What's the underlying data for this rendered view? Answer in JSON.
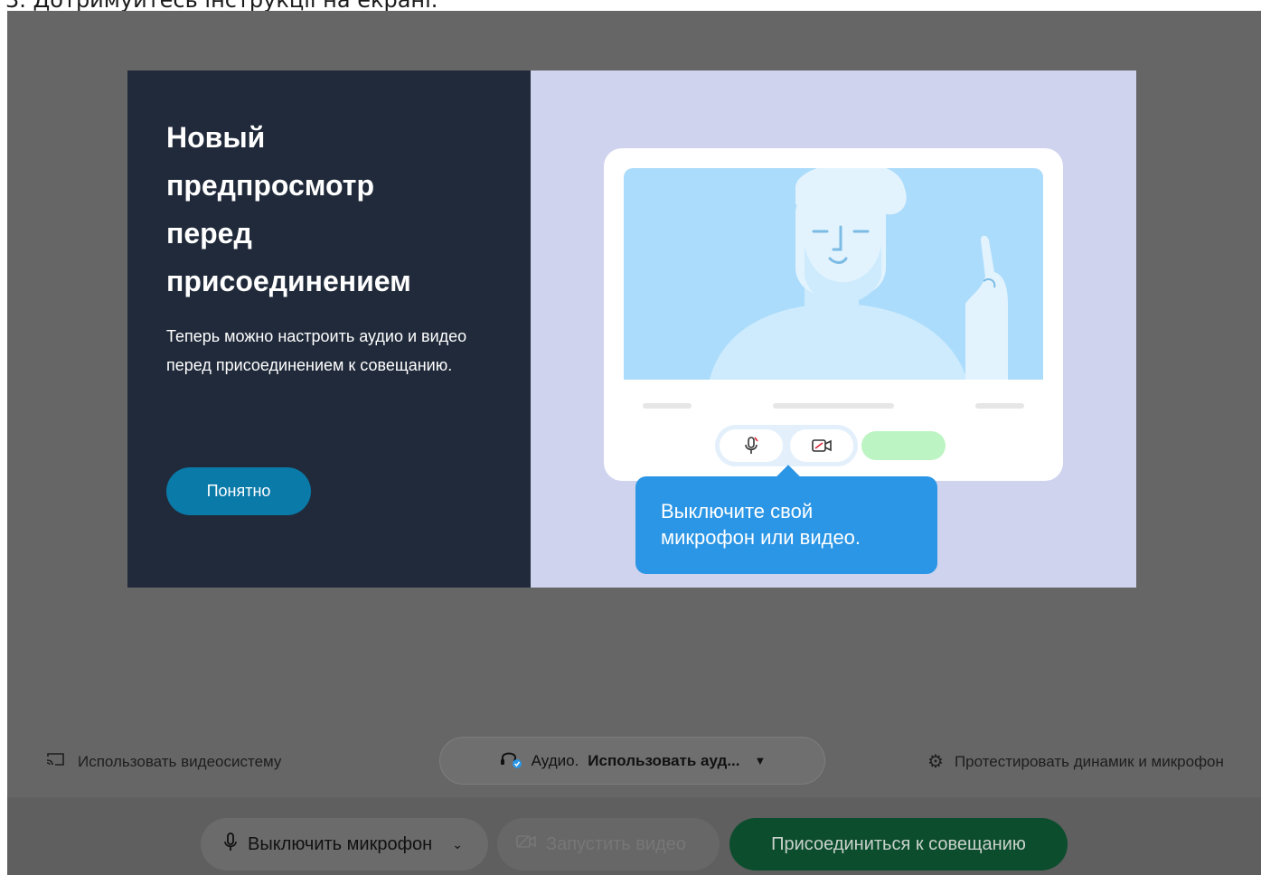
{
  "caption": "3. Дотримуйтесь інструкції на екрані.",
  "modal": {
    "title": "Новый предпросмотр перед присоединением",
    "description": "Теперь можно настроить аудио и видео перед присоединением к совещанию.",
    "ok_label": "Понятно",
    "tooltip": "Выключите свой микрофон или видео."
  },
  "toolbar": {
    "cast_label": "Использовать видеосистему",
    "audio_prefix": "Аудио.",
    "audio_value": "Использовать ауд...",
    "test_label": "Протестировать динамик и микрофон",
    "mic_label": "Выключить микрофон",
    "video_label": "Запустить видео",
    "join_label": "Присоединиться к совещанию"
  },
  "colors": {
    "overlay": "#666666",
    "modal_left": "#202a3a",
    "modal_right": "#cfd3ee",
    "accent_blue": "#0a7aa8",
    "tooltip": "#2b96e5",
    "join_green": "#0c4d2d"
  },
  "icons": [
    "cast-icon",
    "headset-icon",
    "gear-icon",
    "microphone-icon",
    "chevron-down-icon",
    "video-off-icon"
  ]
}
